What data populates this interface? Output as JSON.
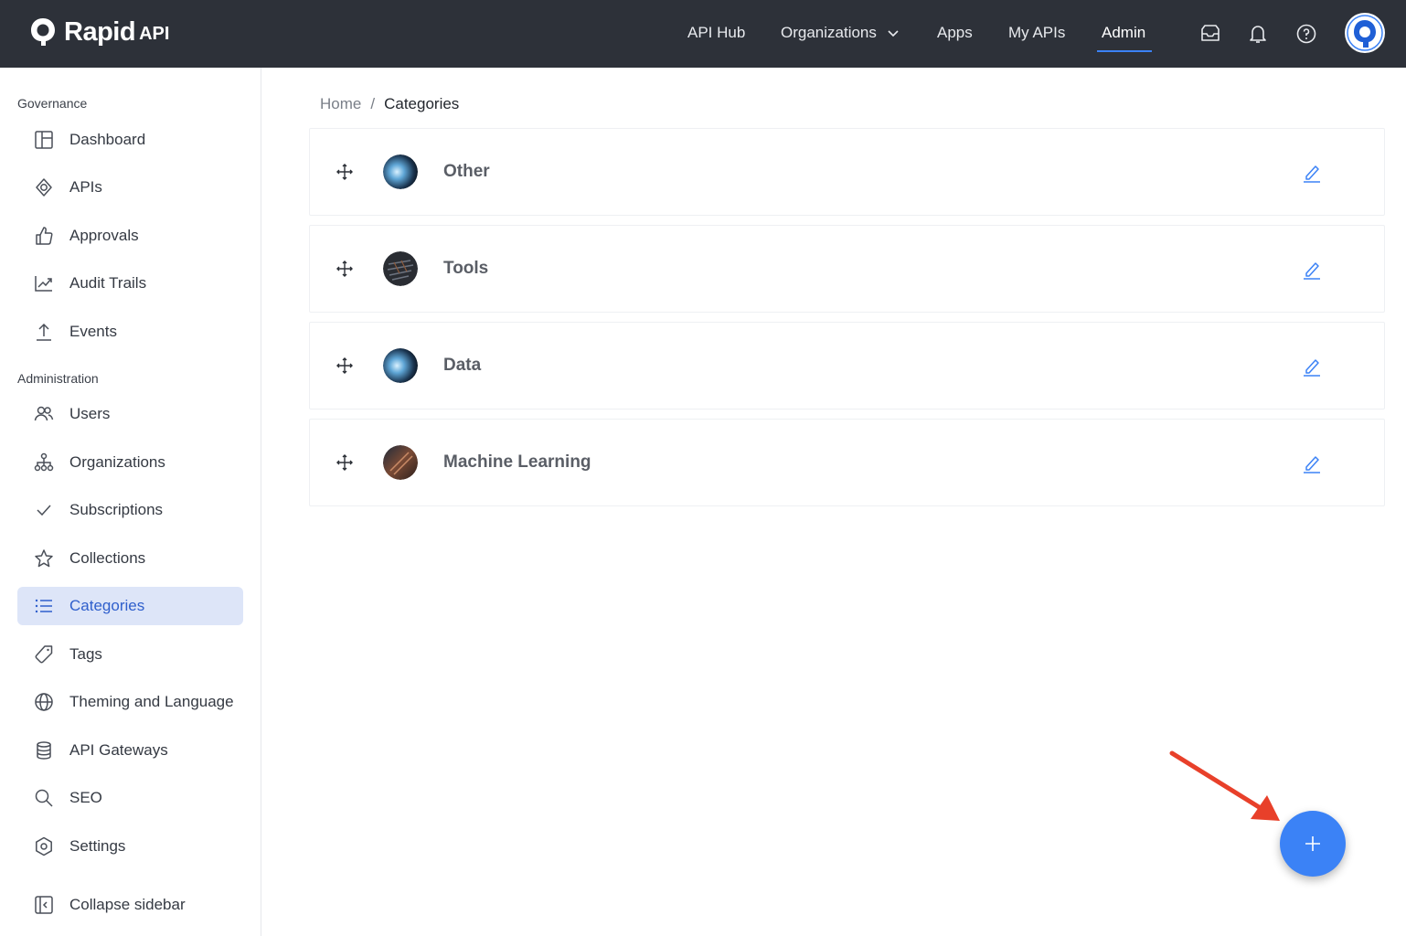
{
  "brand": {
    "name": "Rapid",
    "suffix": "API"
  },
  "nav": {
    "items": [
      {
        "label": "API Hub"
      },
      {
        "label": "Organizations"
      },
      {
        "label": "Apps"
      },
      {
        "label": "My APIs"
      },
      {
        "label": "Admin",
        "active": true
      }
    ]
  },
  "sidebar": {
    "sections": [
      {
        "title": "Governance"
      },
      {
        "title": "Administration"
      }
    ],
    "governance_items": [
      {
        "label": "Dashboard",
        "icon": "dashboard-icon"
      },
      {
        "label": "APIs",
        "icon": "api-icon"
      },
      {
        "label": "Approvals",
        "icon": "thumbs-up-icon"
      },
      {
        "label": "Audit Trails",
        "icon": "chart-line-icon"
      },
      {
        "label": "Events",
        "icon": "upload-icon"
      }
    ],
    "admin_items": [
      {
        "label": "Users",
        "icon": "users-icon"
      },
      {
        "label": "Organizations",
        "icon": "org-tree-icon"
      },
      {
        "label": "Subscriptions",
        "icon": "check-icon"
      },
      {
        "label": "Collections",
        "icon": "star-icon"
      },
      {
        "label": "Categories",
        "icon": "list-icon",
        "active": true
      },
      {
        "label": "Tags",
        "icon": "tag-icon"
      },
      {
        "label": "Theming and Language",
        "icon": "globe-icon"
      },
      {
        "label": "API Gateways",
        "icon": "database-icon"
      },
      {
        "label": "SEO",
        "icon": "search-icon"
      },
      {
        "label": "Settings",
        "icon": "settings-icon"
      }
    ],
    "collapse_label": "Collapse sidebar"
  },
  "breadcrumb": {
    "home": "Home",
    "separator": "/",
    "current": "Categories"
  },
  "categories": [
    {
      "name": "Other"
    },
    {
      "name": "Tools"
    },
    {
      "name": "Data"
    },
    {
      "name": "Machine Learning"
    }
  ],
  "fab": {
    "symbol": "+"
  },
  "colors": {
    "navbar": "#2d3139",
    "accent": "#3b82f6",
    "active_bg": "#dde5f8",
    "annotation_arrow": "#e8402a"
  }
}
